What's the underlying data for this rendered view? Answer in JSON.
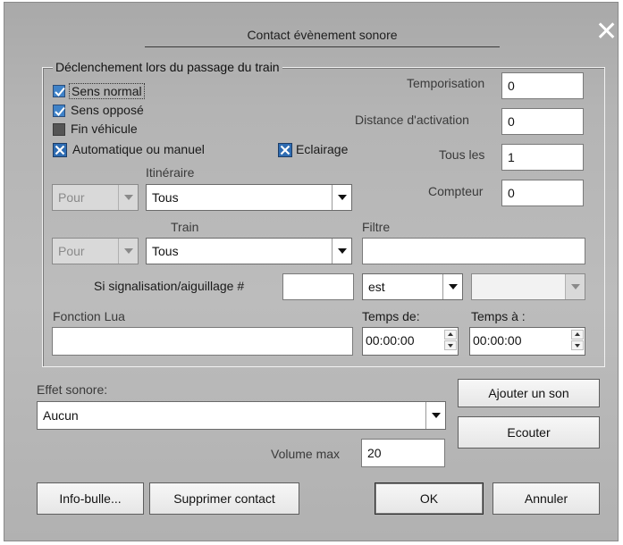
{
  "dialog": {
    "title": "Contact évènement sonore",
    "close_glyph": "✕"
  },
  "trigger_group": {
    "legend": "Déclenchement lors du passage du train",
    "checkboxes": {
      "sens_normal": {
        "label": "Sens normal",
        "checked": true
      },
      "sens_oppose": {
        "label": "Sens opposé",
        "checked": true
      },
      "fin_vehicule": {
        "label": "Fin véhicule",
        "checked": false
      },
      "auto_manuel": {
        "label": "Automatique ou manuel",
        "state": "crossed"
      },
      "eclairage": {
        "label": "Eclairage",
        "state": "crossed"
      }
    },
    "temporisation": {
      "label": "Temporisation",
      "value": "0"
    },
    "distance_activation": {
      "label": "Distance d'activation",
      "value": "0"
    },
    "tous_les": {
      "label": "Tous les",
      "value": "1"
    },
    "compteur": {
      "label": "Compteur",
      "value": "0"
    },
    "itineraire": {
      "label": "Itinéraire",
      "qualifier": "Pour",
      "value": "Tous"
    },
    "train": {
      "label": "Train",
      "qualifier": "Pour",
      "value": "Tous"
    },
    "filtre": {
      "label": "Filtre",
      "value": ""
    },
    "signalisation": {
      "label": "Si signalisation/aiguillage #",
      "value": "",
      "operator": "est",
      "target": ""
    },
    "fonction_lua": {
      "label": "Fonction Lua",
      "value": ""
    },
    "temps_de": {
      "label": "Temps de:",
      "value": "00:00:00"
    },
    "temps_a": {
      "label": "Temps à :",
      "value": "00:00:00"
    }
  },
  "sound": {
    "effect_label": "Effet sonore:",
    "effect_value": "Aucun",
    "add_button": "Ajouter un son",
    "listen_button": "Ecouter",
    "volume_label": "Volume max",
    "volume_value": "20"
  },
  "footer": {
    "tooltip_button": "Info-bulle...",
    "delete_button": "Supprimer contact",
    "ok_button": "OK",
    "cancel_button": "Annuler"
  },
  "icons": {
    "checkbox_checked": "check-icon",
    "checkbox_crossed": "cross-icon",
    "dropdown": "chevron-down-icon",
    "close": "close-icon"
  },
  "colors": {
    "dialog_bg": "#b4b4b4",
    "checkbox_blue": "#3f82c8",
    "field_bg": "#ffffff",
    "close_glyph": "#ffffff"
  }
}
